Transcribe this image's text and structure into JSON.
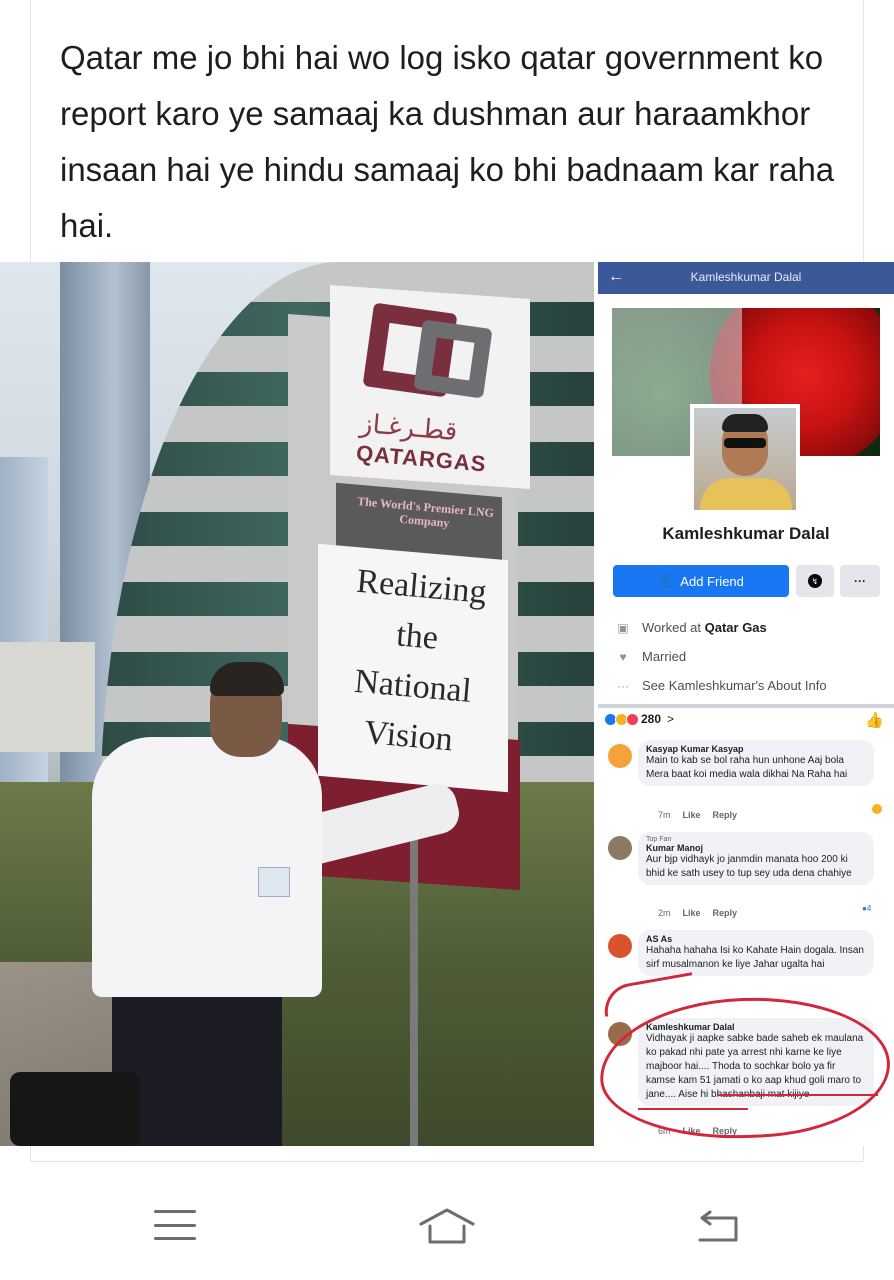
{
  "post": {
    "text": "Qatar me jo bhi hai wo log isko qatar government ko report karo ye samaaj ka dushman aur haraamkhor insaan hai ye hindu samaaj ko bhi badnaam kar raha hai."
  },
  "photo": {
    "sign_arabic": "قطـرغـاز",
    "sign_brand": "QATARGAS",
    "sign_tagline": "The World's Premier LNG Company",
    "sign_slogan_lines": [
      "Realizing",
      "the",
      "National",
      "Vision"
    ]
  },
  "screenshot": {
    "header_title": "Kamleshkumar Dalal",
    "profile_name": "Kamleshkumar Dalal",
    "add_friend_label": "Add Friend",
    "more_label": "···",
    "work_prefix": "Worked at ",
    "work_place": "Qatar Gas",
    "relationship": "Married",
    "about_link": "See Kamleshkumar's About Info",
    "reaction_count": "280",
    "reaction_chevron": ">",
    "comments": [
      {
        "name": "Kasyap Kumar Kasyap",
        "badge": "",
        "text": "Main to kab se bol raha hun unhone Aaj bola Mera baat koi media wala dikhai Na Raha hai",
        "time": "7m",
        "like": "Like",
        "reply": "Reply",
        "reaction_count": ""
      },
      {
        "name": "Kumar Manoj",
        "badge": "Top Fan",
        "text": "Aur bjp vidhayk jo janmdin manata hoo 200 ki bhid ke sath usey to tup sey uda dena chahiye",
        "time": "2m",
        "like": "Like",
        "reply": "Reply",
        "reaction_count": "4"
      },
      {
        "name": "AS As",
        "badge": "",
        "text": "Hahaha hahaha Isi ko Kahate Hain dogala. Insan sirf musalmanon ke liye Jahar ugalta hai",
        "time": "",
        "like": "",
        "reply": "",
        "reaction_count": ""
      },
      {
        "name": "Kamleshkumar Dalal",
        "badge": "",
        "text": "Vidhayak ji aapke sabke bade saheb ek maulana ko pakad nhi pate ya arrest nhi karne ke liye majboor hai.... Thoda to sochkar bolo ya fir kamse kam 51 jamati o ko aap khud goli maro to jane.... Aise hi bhashanbaji mat kijiye",
        "time": "6m",
        "like": "Like",
        "reply": "Reply",
        "reaction_count": ""
      }
    ]
  },
  "colors": {
    "fb_blue": "#3b5998",
    "button_blue": "#1877f2",
    "annotation_red": "#d3273a",
    "qatargas_maroon": "#7a2f3e"
  },
  "icons": [
    "back-arrow-icon",
    "add-person-icon",
    "messenger-icon",
    "briefcase-icon",
    "heart-icon",
    "more-dots-icon",
    "like-thumb-icon",
    "menu-icon",
    "home-icon",
    "back-icon"
  ]
}
